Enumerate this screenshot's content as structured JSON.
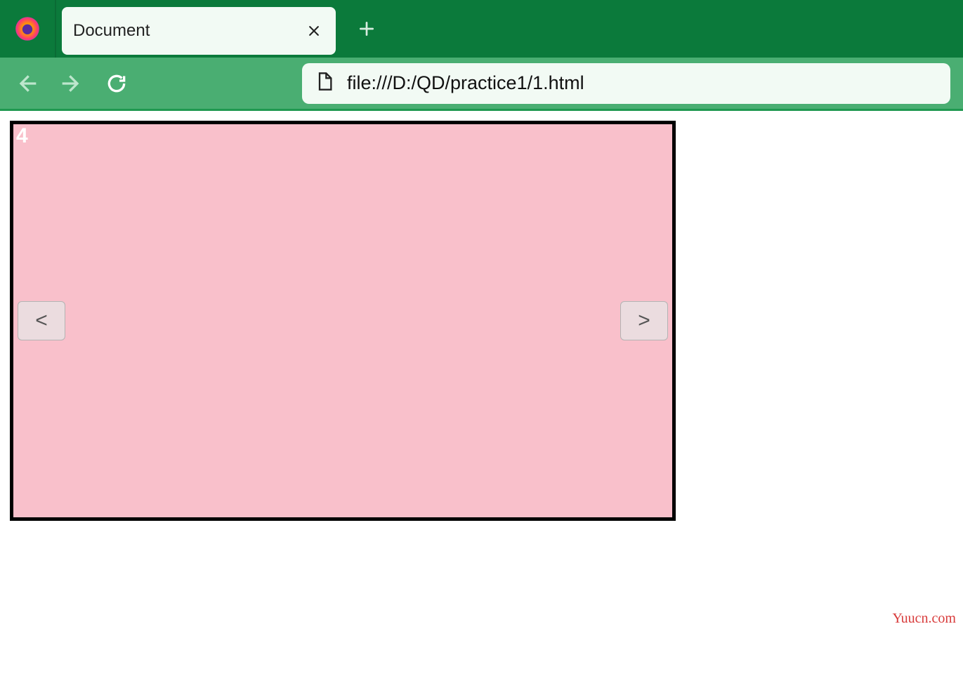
{
  "browser": {
    "tab_title": "Document",
    "url": "file:///D:/QD/practice1/1.html"
  },
  "page": {
    "slide_number": "4",
    "prev_label": "<",
    "next_label": ">",
    "slider_bg": "#f9c0cb"
  },
  "watermark": "Yuucn.com"
}
